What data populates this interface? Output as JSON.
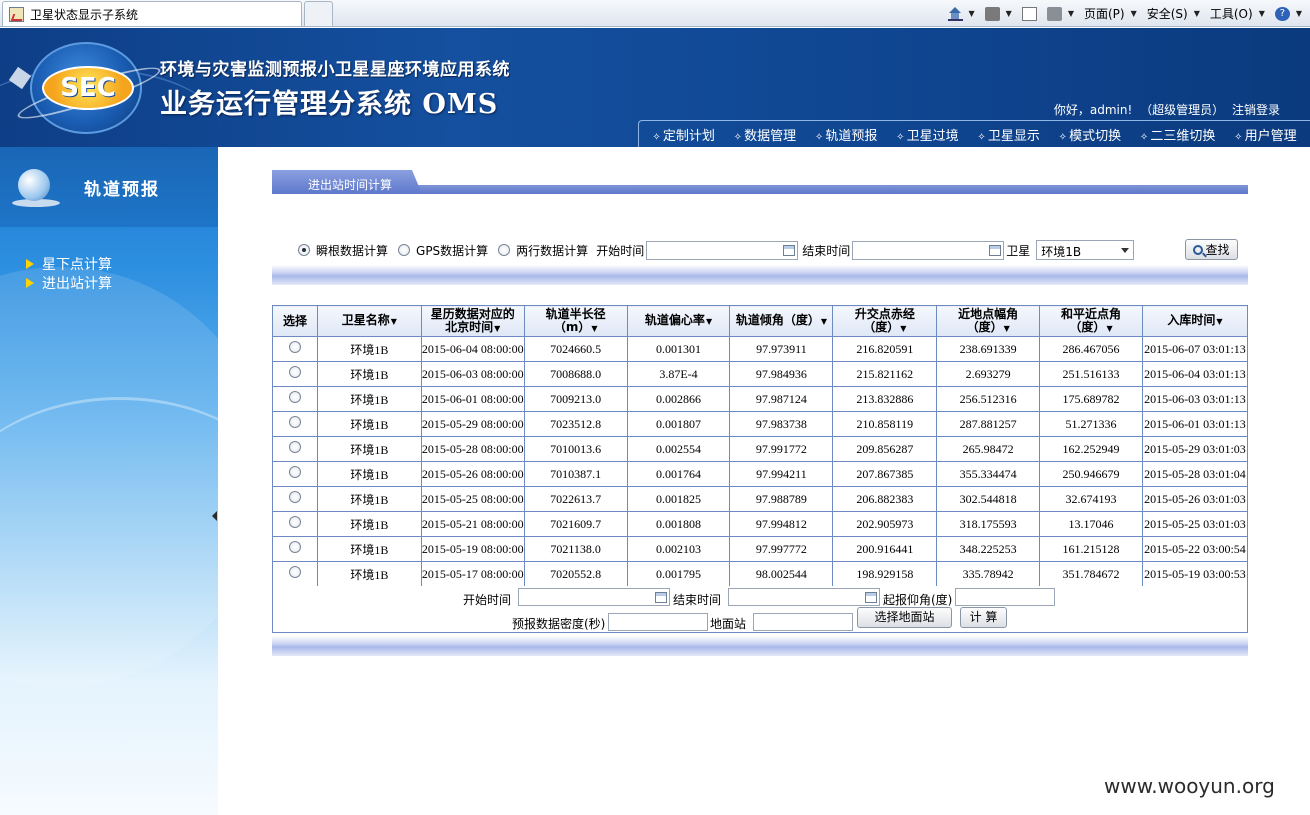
{
  "browser": {
    "tab_title": "卫星状态显示子系统",
    "tools": {
      "page": "页面(P)",
      "safety": "安全(S)",
      "tools": "工具(O)",
      "help": "?"
    }
  },
  "header": {
    "logo_text": "SEC",
    "subtitle": "环境与灾害监测预报小卫星星座环境应用系统",
    "title": "业务运行管理分系统 OMS",
    "user": {
      "greeting": "你好，admin!",
      "role": "（超级管理员）",
      "logout": "注销登录"
    },
    "nav": [
      "定制计划",
      "数据管理",
      "轨道预报",
      "卫星过境",
      "卫星显示",
      "模式切换",
      "二三维切换",
      "用户管理"
    ]
  },
  "sidebar": {
    "title": "轨道预报",
    "items": [
      "星下点计算",
      "进出站计算"
    ]
  },
  "section": {
    "tab_label": "进出站时间计算"
  },
  "filter": {
    "radios": [
      {
        "label": "瞬根数据计算",
        "checked": true
      },
      {
        "label": "GPS数据计算",
        "checked": false
      },
      {
        "label": "两行数据计算",
        "checked": false
      }
    ],
    "start_label": "开始时间",
    "end_label": "结束时间",
    "satellite_label": "卫星",
    "satellite_value": "环境1B",
    "search_label": "查找"
  },
  "table": {
    "headers": [
      {
        "l1": "选择",
        "l2": "",
        "sort": false
      },
      {
        "l1": "卫星名称",
        "l2": "",
        "sort": true
      },
      {
        "l1": "星历数据对应的",
        "l2": "北京时间",
        "sort": true
      },
      {
        "l1": "轨道半长径",
        "l2": "（m）",
        "sort": true
      },
      {
        "l1": "轨道偏心率",
        "l2": "",
        "sort": true
      },
      {
        "l1": "轨道倾角（度）",
        "l2": "",
        "sort": true
      },
      {
        "l1": "升交点赤经",
        "l2": "（度）",
        "sort": true
      },
      {
        "l1": "近地点幅角",
        "l2": "（度）",
        "sort": true
      },
      {
        "l1": "和平近点角",
        "l2": "（度）",
        "sort": true
      },
      {
        "l1": "入库时间",
        "l2": "",
        "sort": true
      }
    ],
    "rows": [
      [
        "环境1B",
        "2015-06-04 08:00:00",
        "7024660.5",
        "0.001301",
        "97.973911",
        "216.820591",
        "238.691339",
        "286.467056",
        "2015-06-07 03:01:13"
      ],
      [
        "环境1B",
        "2015-06-03 08:00:00",
        "7008688.0",
        "3.87E-4",
        "97.984936",
        "215.821162",
        "2.693279",
        "251.516133",
        "2015-06-04 03:01:13"
      ],
      [
        "环境1B",
        "2015-06-01 08:00:00",
        "7009213.0",
        "0.002866",
        "97.987124",
        "213.832886",
        "256.512316",
        "175.689782",
        "2015-06-03 03:01:13"
      ],
      [
        "环境1B",
        "2015-05-29 08:00:00",
        "7023512.8",
        "0.001807",
        "97.983738",
        "210.858119",
        "287.881257",
        "51.271336",
        "2015-06-01 03:01:13"
      ],
      [
        "环境1B",
        "2015-05-28 08:00:00",
        "7010013.6",
        "0.002554",
        "97.991772",
        "209.856287",
        "265.98472",
        "162.252949",
        "2015-05-29 03:01:03"
      ],
      [
        "环境1B",
        "2015-05-26 08:00:00",
        "7010387.1",
        "0.001764",
        "97.994211",
        "207.867385",
        "355.334474",
        "250.946679",
        "2015-05-28 03:01:04"
      ],
      [
        "环境1B",
        "2015-05-25 08:00:00",
        "7022613.7",
        "0.001825",
        "97.988789",
        "206.882383",
        "302.544818",
        "32.674193",
        "2015-05-26 03:01:03"
      ],
      [
        "环境1B",
        "2015-05-21 08:00:00",
        "7021609.7",
        "0.001808",
        "97.994812",
        "202.905973",
        "318.175593",
        "13.17046",
        "2015-05-25 03:01:03"
      ],
      [
        "环境1B",
        "2015-05-19 08:00:00",
        "7021138.0",
        "0.002103",
        "97.997772",
        "200.916441",
        "348.225253",
        "161.215128",
        "2015-05-22 03:00:54"
      ],
      [
        "环境1B",
        "2015-05-17 08:00:00",
        "7020552.8",
        "0.001795",
        "98.002544",
        "198.929158",
        "335.78942",
        "351.784672",
        "2015-05-19 03:00:53"
      ]
    ]
  },
  "calc": {
    "start_label": "开始时间",
    "end_label": "结束时间",
    "elevation_label": "起报仰角(度)",
    "density_label": "预报数据密度(秒)",
    "station_label": "地面站",
    "select_station_button": "选择地面站",
    "compute_button": "计 算"
  },
  "watermark": "www.wooyun.org"
}
